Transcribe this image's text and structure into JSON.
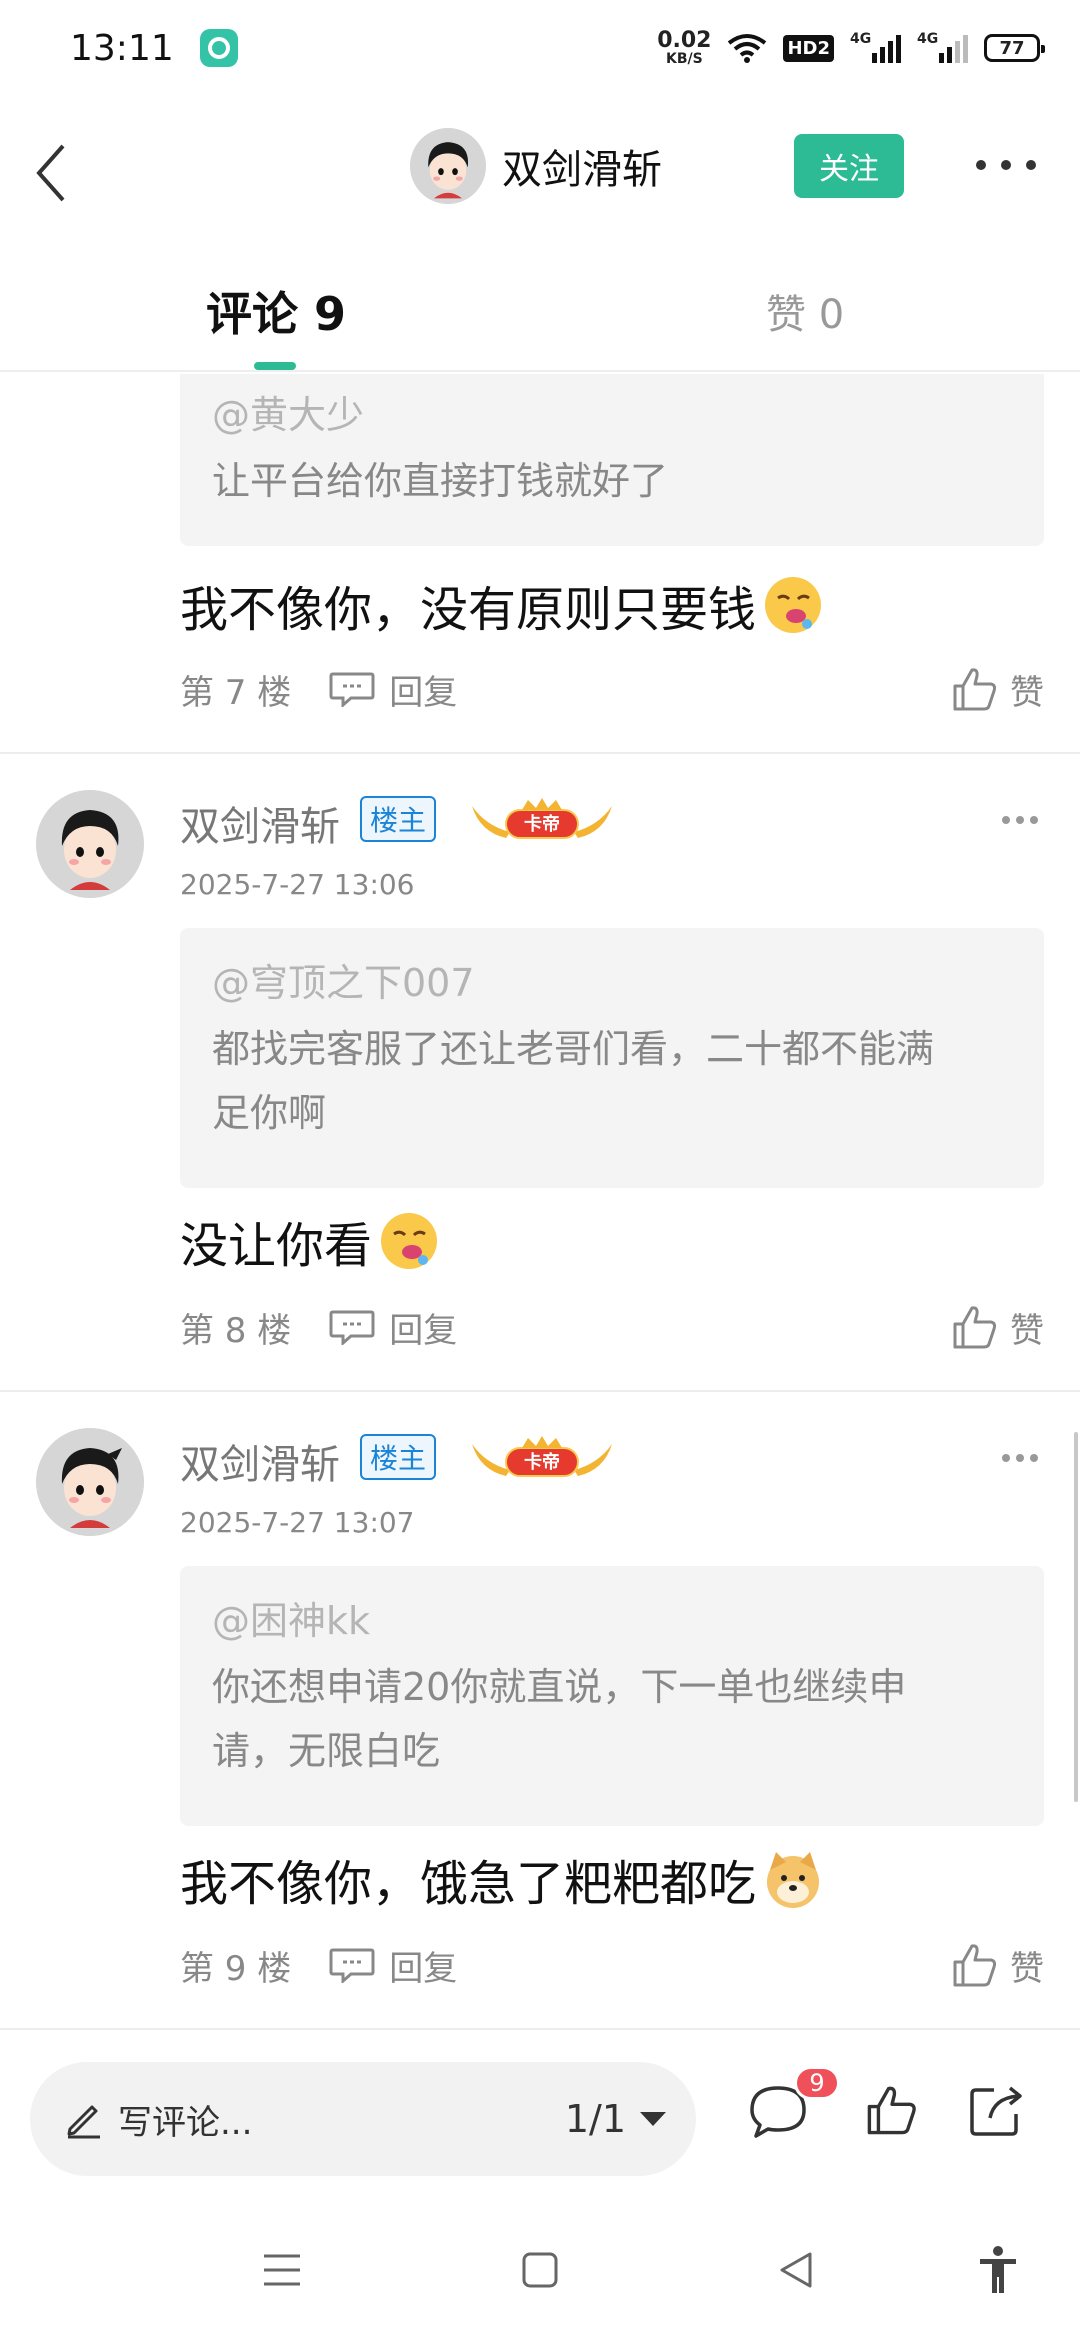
{
  "status_bar": {
    "time": "13:11",
    "net_speed_value": "0.02",
    "net_speed_unit": "KB/S",
    "hd_label": "HD2",
    "signal_1": "4G",
    "signal_2": "4G",
    "battery": "77"
  },
  "header": {
    "title": "双剑滑斩",
    "follow_label": "关注"
  },
  "tabs": {
    "comments_label": "评论 9",
    "likes_label": "赞 0"
  },
  "comments": [
    {
      "quote_user": "@黄大少",
      "quote_text": "让平台给你直接打钱就好了",
      "body": "我不像你，没有原则只要钱",
      "floor": "第 7 楼",
      "reply_label": "回复",
      "like_label": "赞"
    },
    {
      "author": "双剑滑斩",
      "host_badge": "楼主",
      "rank_badge": "卡帝",
      "time": "2025-7-27 13:06",
      "quote_user": "@穹顶之下007",
      "quote_text_line1": "都找完客服了还让老哥们看，二十都不能满",
      "quote_text_line2": "足你啊",
      "body": "没让你看",
      "floor": "第 8 楼",
      "reply_label": "回复",
      "like_label": "赞"
    },
    {
      "author": "双剑滑斩",
      "host_badge": "楼主",
      "rank_badge": "卡帝",
      "time": "2025-7-27 13:07",
      "quote_user": "@困神kk",
      "quote_text_line1": "你还想申请20你就直说，下一单也继续申",
      "quote_text_line2": "请，无限白吃",
      "body": "我不像你，饿急了粑粑都吃",
      "floor": "第 9 楼",
      "reply_label": "回复",
      "like_label": "赞"
    }
  ],
  "bottom_bar": {
    "write_placeholder": "写评论...",
    "page_indicator": "1/1",
    "comment_count": "9"
  },
  "colors": {
    "accent": "#2dbb96",
    "host_badge": "#1b84d6",
    "badge_red": "#f0505a"
  },
  "icons": [
    "back-icon",
    "more-icon",
    "reply-icon",
    "like-icon",
    "pencil-icon",
    "comment-icon",
    "share-icon",
    "menu-icon",
    "home-icon",
    "nav-back-icon",
    "accessibility-icon"
  ]
}
